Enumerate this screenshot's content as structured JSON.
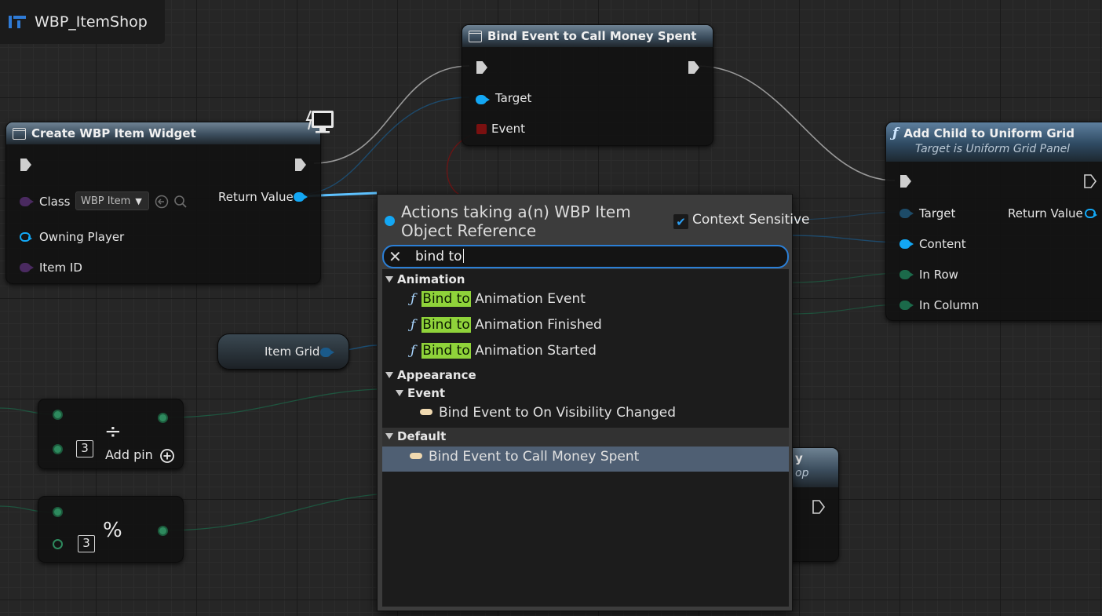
{
  "graph_title": "WBP_ItemShop",
  "nodes": {
    "create_widget": {
      "title": "Create WBP Item Widget",
      "class_label": "Class",
      "class_value": "WBP Item",
      "return_value": "Return Value",
      "owning_player": "Owning Player",
      "item_id": "Item ID"
    },
    "bind_event": {
      "title": "Bind Event to Call Money Spent",
      "target": "Target",
      "event": "Event"
    },
    "add_child": {
      "title": "Add Child to Uniform Grid",
      "subtitle": "Target is Uniform Grid Panel",
      "target": "Target",
      "return_value": "Return Value",
      "content": "Content",
      "in_row": "In Row",
      "in_column": "In Column"
    },
    "item_grid": {
      "label": "Item Grid"
    },
    "divide": {
      "symbol": "÷",
      "value": "3",
      "add_pin": "Add pin"
    },
    "modulo": {
      "symbol": "%",
      "value": "3"
    },
    "hidden_node": {
      "title_fragment": "y",
      "subtitle_fragment": "op"
    }
  },
  "context_menu": {
    "header": "Actions taking a(n) WBP Item Object Reference",
    "context_sensitive_label": "Context Sensitive",
    "context_sensitive_checked": true,
    "search_value": "bind to",
    "highlight": "Bind to",
    "categories": {
      "animation": "Animation",
      "appearance": "Appearance",
      "event": "Event",
      "default": "Default"
    },
    "animation_items": [
      {
        "rest": "Animation Event"
      },
      {
        "rest": "Animation Finished"
      },
      {
        "rest": "Animation Started"
      }
    ],
    "appearance_event_item": "Bind Event to On Visibility Changed",
    "default_item": "Bind Event to Call Money Spent"
  },
  "colors": {
    "object_pin": "#13a7f4",
    "search_border": "#2b7fd6",
    "highlight": "#8fd33a",
    "selected_row": "#4f5f73"
  }
}
